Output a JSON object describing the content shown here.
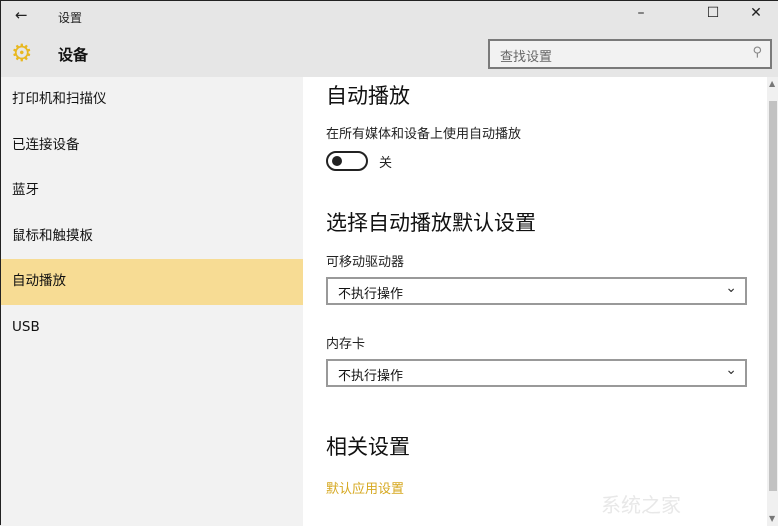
{
  "window": {
    "title": "设置",
    "back": "←",
    "minimize": "–",
    "maximize": "☐",
    "close": "✕"
  },
  "header": {
    "title": "设备",
    "search_placeholder": "查找设置"
  },
  "sidebar": {
    "items": [
      {
        "label": "打印机和扫描仪"
      },
      {
        "label": "已连接设备"
      },
      {
        "label": "蓝牙"
      },
      {
        "label": "鼠标和触摸板"
      },
      {
        "label": "自动播放"
      },
      {
        "label": "USB"
      }
    ],
    "active": 4
  },
  "main": {
    "autoplay_title": "自动播放",
    "autoplay_desc": "在所有媒体和设备上使用自动播放",
    "toggle_state": "关",
    "defaults_title": "选择自动播放默认设置",
    "removable_label": "可移动驱动器",
    "removable_value": "不执行操作",
    "memcard_label": "内存卡",
    "memcard_value": "不执行操作",
    "related_title": "相关设置",
    "related_link": "默认应用设置"
  },
  "watermark": "系统之家",
  "colors": {
    "accent": "#e8b820",
    "active_bg": "#f7dc94",
    "link": "#d6a820"
  }
}
